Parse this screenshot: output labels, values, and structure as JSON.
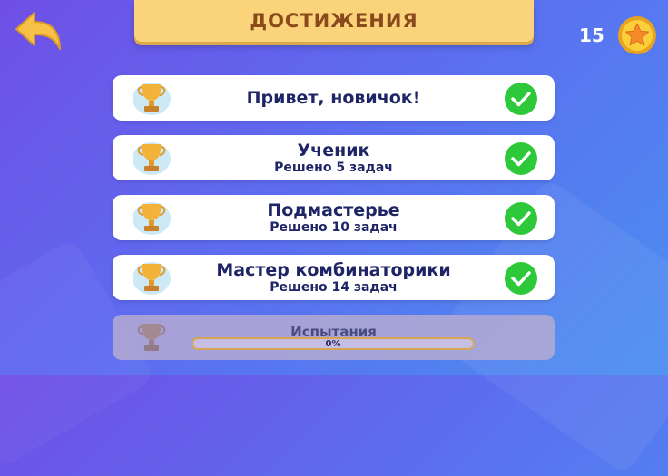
{
  "header": {
    "title": "ДОСТИЖЕНИЯ"
  },
  "coins": {
    "count": "15"
  },
  "achievements": [
    {
      "name": "Привет, новичок!",
      "subtitle": "",
      "completed": true
    },
    {
      "name": "Ученик",
      "subtitle": "Решено 5 задач",
      "completed": true
    },
    {
      "name": "Подмастерье",
      "subtitle": "Решено 10 задач",
      "completed": true
    },
    {
      "name": "Мастер комбинаторики",
      "subtitle": "Решено 14 задач",
      "completed": true
    }
  ],
  "locked_achievement": {
    "name": "Испытания",
    "progress_label": "0%",
    "progress": 0
  },
  "colors": {
    "banner": "#fad37a",
    "title_text": "#8a4a1c",
    "check_green": "#2ec93b",
    "card_text": "#1e2566",
    "back_arrow": "#f7c046"
  },
  "icons": {
    "back": "back-arrow-icon",
    "coin": "star-coin-icon",
    "trophy": "trophy-icon",
    "check": "checkmark-icon"
  }
}
